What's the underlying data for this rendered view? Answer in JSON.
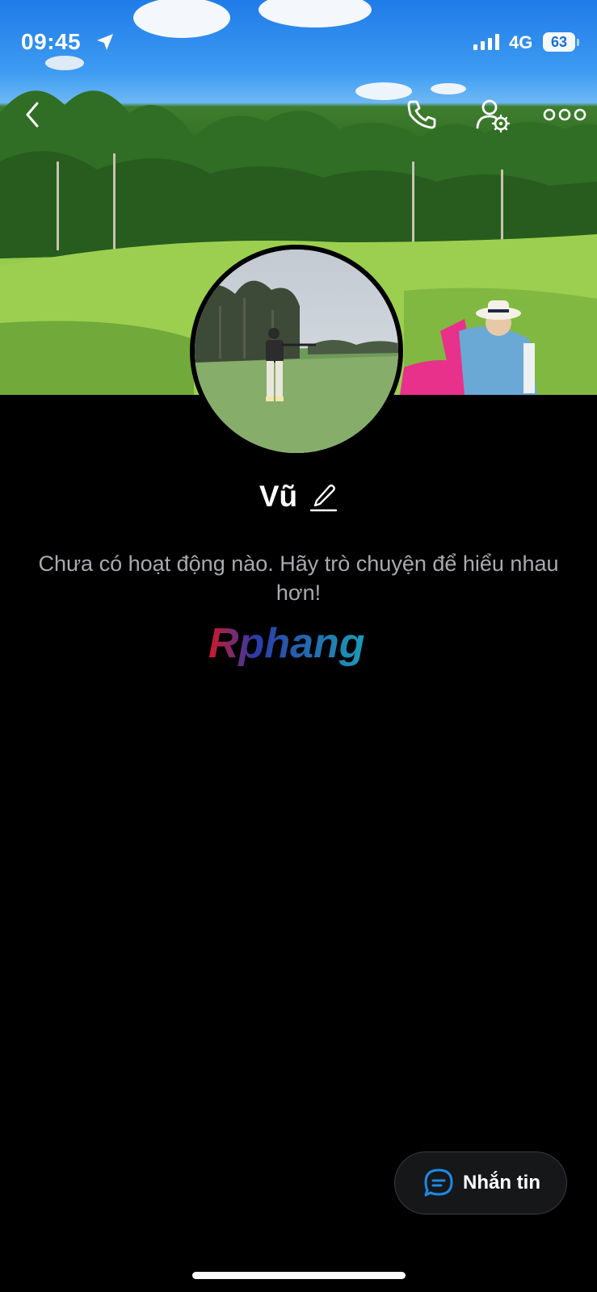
{
  "status_bar": {
    "time": "09:45",
    "network": "4G",
    "battery": "63"
  },
  "header": {
    "icons": [
      "back-icon",
      "phone-icon",
      "user-settings-icon",
      "more-icon"
    ]
  },
  "profile": {
    "name": "Vũ",
    "empty_message": "Chưa có hoạt động nào. Hãy trò chuyện để hiểu nhau hơn!",
    "watermark": "Rphang"
  },
  "actions": {
    "message_label": "Nhắn tin"
  },
  "colors": {
    "background": "#000000",
    "muted_text": "#a7aaae",
    "accent": "#1e88e5",
    "button_bg": "#161719"
  }
}
